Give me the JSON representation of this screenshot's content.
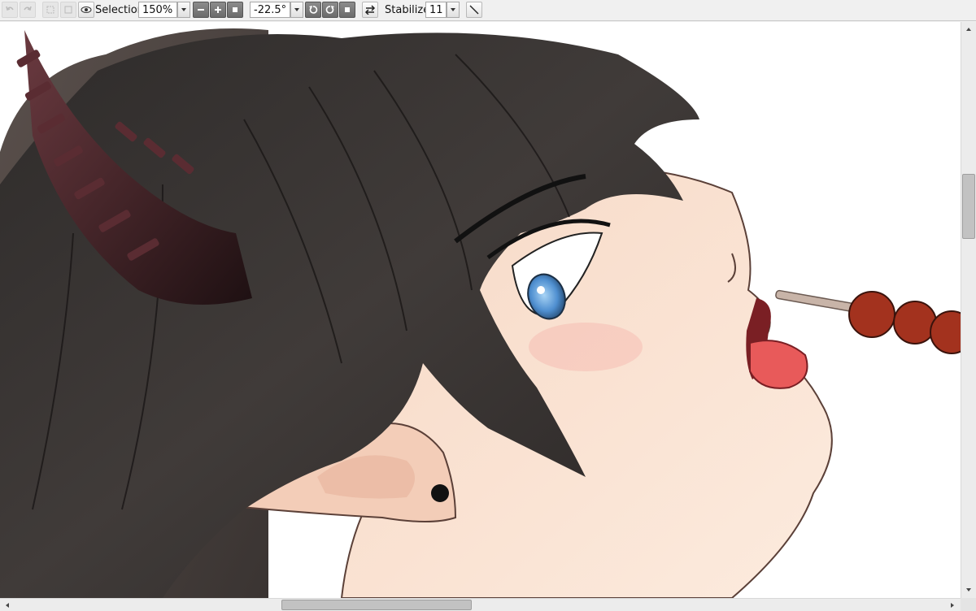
{
  "toolbar": {
    "selection_label": "Selection",
    "zoom_value": "150%",
    "rotation_value": "-22.5°",
    "stabilizer_label": "Stabilizer",
    "stabilizer_value": "11"
  },
  "icons": {
    "undo": "undo-icon",
    "redo": "redo-icon",
    "deselect": "deselect-icon",
    "invert": "invert-icon",
    "eye": "eye-icon",
    "zoom_out": "minus-icon",
    "zoom_in": "plus-icon",
    "zoom_reset": "square-icon",
    "rotate_ccw": "rotate-left-icon",
    "rotate_cw": "rotate-right-icon",
    "rotate_reset": "square-icon",
    "flip": "flip-arrows-icon",
    "line_tool": "diagonal-line-icon"
  },
  "colors": {
    "hair": "#3a3634",
    "horn": "#4a2428",
    "skin": "#fbe5d6",
    "eye": "#4f8fd0",
    "tongue": "#e85a5a",
    "dango": "#a3321e"
  },
  "scroll": {
    "vertical_position": 0.26,
    "horizontal_position": 0.33
  }
}
